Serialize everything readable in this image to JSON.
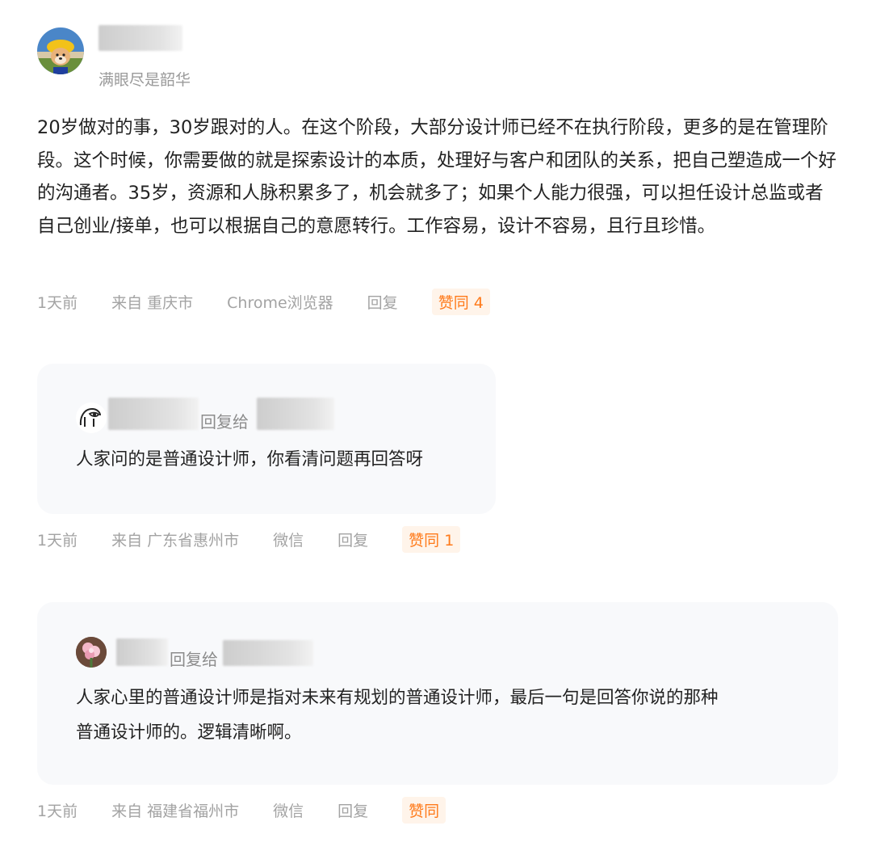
{
  "comment": {
    "signature": "满眼尽是韶华",
    "body": "20岁做对的事，30岁跟对的人。在这个阶段，大部分设计师已经不在执行阶段，更多的是在管理阶段。这个时候，你需要做的就是探索设计的本质，处理好与客户和团队的关系，把自己塑造成一个好的沟通者。35岁，资源和人脉积累多了，机会就多了；如果个人能力很强，可以担任设计总监或者自己创业/接单，也可以根据自己的意愿转行。工作容易，设计不容易，且行且珍惜。",
    "meta": {
      "time": "1天前",
      "location": "来自 重庆市",
      "client": "Chrome浏览器",
      "reply": "回复",
      "like": "赞同 4"
    }
  },
  "replies": [
    {
      "reply_to_label": "回复给",
      "text": "人家问的是普通设计师，你看清问题再回答呀",
      "meta": {
        "time": "1天前",
        "location": "来自 广东省惠州市",
        "client": "微信",
        "reply": "回复",
        "like": "赞同 1"
      }
    },
    {
      "reply_to_label": "回复给",
      "text_lines": [
        "人家心里的普通设计师是指对未来有规划的普通设计师，最后一句是回答你说的那种",
        "普通设计师的。逻辑清晰啊。"
      ],
      "meta": {
        "time": "1天前",
        "location": "来自 福建省福州市",
        "client": "微信",
        "reply": "回复",
        "like": "赞同"
      }
    }
  ],
  "colors": {
    "like_text": "#ff7a1a",
    "like_bg": "#fff4ea",
    "meta_text": "#a3a3a3",
    "reply_bg": "#f8f9fb"
  },
  "icons": {
    "main_avatar": "dog-avatar-icon",
    "reply1_avatar": "sketch-face-avatar-icon",
    "reply2_avatar": "flower-avatar-icon"
  }
}
